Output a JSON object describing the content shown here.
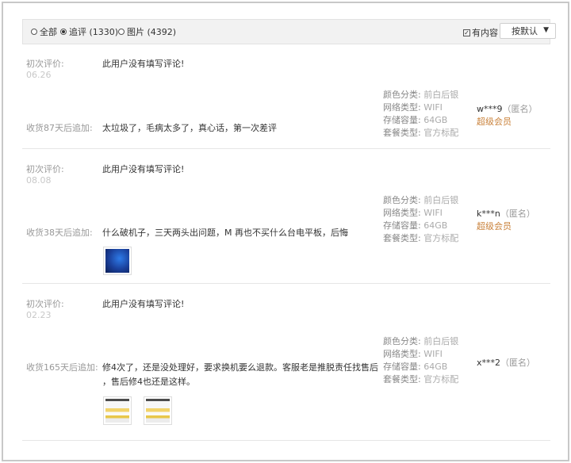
{
  "filters": {
    "all": "全部",
    "followup": "追评 (1330)",
    "images": "图片 (4392)",
    "has_content": "有内容",
    "sort_label": "按默认"
  },
  "reviews": [
    {
      "initial_label": "初次评价:",
      "initial_date": "06.26",
      "initial_text": "此用户没有填写评论!",
      "followup_label": "收货87天后追加:",
      "followup_text_1": "太垃圾了，毛病太多了，真心话，第一次差评",
      "specs": [
        {
          "k": "颜色分类:",
          "v": "前白后银"
        },
        {
          "k": "网络类型:",
          "v": "WIFI"
        },
        {
          "k": "存储容量:",
          "v": "64GB"
        },
        {
          "k": "套餐类型:",
          "v": "官方标配"
        }
      ],
      "user": "w***9",
      "anon": "（匿名）",
      "member": "超级会员"
    },
    {
      "initial_label": "初次评价:",
      "initial_date": "08.08",
      "initial_text": "此用户没有填写评论!",
      "followup_label": "收货38天后追加:",
      "followup_text_1": "什么破机子，三天两头出问题，M 再也不买什么台电平板，后悔",
      "specs": [
        {
          "k": "颜色分类:",
          "v": "前白后银"
        },
        {
          "k": "网络类型:",
          "v": "WIFI"
        },
        {
          "k": "存储容量:",
          "v": "64GB"
        },
        {
          "k": "套餐类型:",
          "v": "官方标配"
        }
      ],
      "user": "k***n",
      "anon": "（匿名）",
      "member": "超级会员"
    },
    {
      "initial_label": "初次评价:",
      "initial_date": "02.23",
      "initial_text": "此用户没有填写评论!",
      "followup_label": "收货165天后追加:",
      "followup_text_1": "修4次了，还是没处理好，要求换机要么退款。客服老是推脱责任找售后",
      "followup_text_2": "，售后修4也还是这样。",
      "specs": [
        {
          "k": "颜色分类:",
          "v": "前白后银"
        },
        {
          "k": "网络类型:",
          "v": "WIFI"
        },
        {
          "k": "存储容量:",
          "v": "64GB"
        },
        {
          "k": "套餐类型:",
          "v": "官方标配"
        }
      ],
      "user": "x***2",
      "anon": "（匿名）"
    }
  ]
}
